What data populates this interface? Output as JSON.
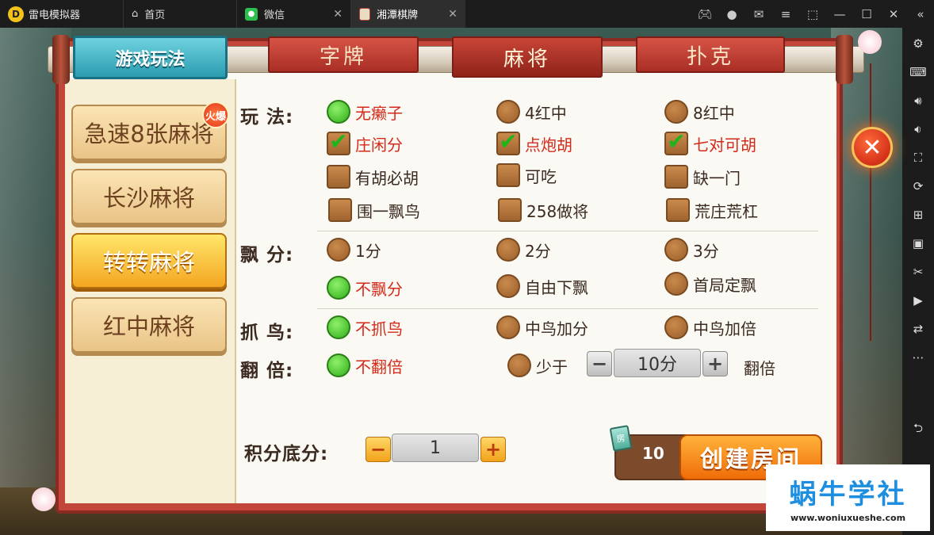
{
  "titlebar": {
    "app_name": "雷电模拟器",
    "tabs": [
      {
        "label": "首页"
      },
      {
        "label": "微信"
      },
      {
        "label": "湘潭棋牌"
      }
    ]
  },
  "dialog": {
    "title": "游戏玩法",
    "top_tabs": [
      {
        "label": "字牌"
      },
      {
        "label": "麻将"
      },
      {
        "label": "扑克"
      }
    ],
    "active_tab": "麻将",
    "modes": [
      {
        "label": "急速8张麻将",
        "badge": "火爆"
      },
      {
        "label": "长沙麻将"
      },
      {
        "label": "转转麻将"
      },
      {
        "label": "红中麻将"
      }
    ],
    "active_mode": "转转麻将",
    "wanfa": {
      "label": "玩    法:",
      "options": [
        {
          "label": "无癞子",
          "selected": true
        },
        {
          "label": "4红中",
          "selected": false
        },
        {
          "label": "8红中",
          "selected": false
        }
      ],
      "checks": [
        {
          "label": "庄闲分",
          "checked": true
        },
        {
          "label": "点炮胡",
          "checked": true
        },
        {
          "label": "七对可胡",
          "checked": true
        },
        {
          "label": "有胡必胡",
          "checked": false
        },
        {
          "label": "可吃",
          "checked": false
        },
        {
          "label": "缺一门",
          "checked": false
        },
        {
          "label": "围一飘鸟",
          "checked": false
        },
        {
          "label": "258做将",
          "checked": false
        },
        {
          "label": "荒庄荒杠",
          "checked": false
        }
      ]
    },
    "piaofen": {
      "label": "飘    分:",
      "options": [
        {
          "label": "1分",
          "selected": false
        },
        {
          "label": "2分",
          "selected": false
        },
        {
          "label": "3分",
          "selected": false
        },
        {
          "label": "不飘分",
          "selected": true
        },
        {
          "label": "自由下飘",
          "selected": false
        },
        {
          "label": "首局定飘",
          "selected": false
        }
      ]
    },
    "zhuaniao": {
      "label": "抓    鸟:",
      "options": [
        {
          "label": "不抓鸟",
          "selected": true
        },
        {
          "label": "中鸟加分",
          "selected": false
        },
        {
          "label": "中鸟加倍",
          "selected": false
        }
      ]
    },
    "fanbei": {
      "label": "翻    倍:",
      "options": [
        {
          "label": "不翻倍",
          "selected": true
        },
        {
          "label": "少于",
          "selected": false
        }
      ],
      "stepper_value": "10分",
      "suffix": "翻倍"
    },
    "score_base": {
      "label": "积分底分:",
      "value": "1"
    },
    "create": {
      "card_icon_text": "房",
      "cost": "10",
      "button_label": "创建房间"
    },
    "close_symbol": "✕"
  },
  "watermark": {
    "title": "蜗牛学社",
    "url": "www.woniuxueshe.com"
  },
  "colors": {
    "accent_red": "#d52a1a",
    "selected_green": "#2fae1a",
    "active_mode_orange": "#f4a621",
    "create_orange": "#ef6d09"
  }
}
